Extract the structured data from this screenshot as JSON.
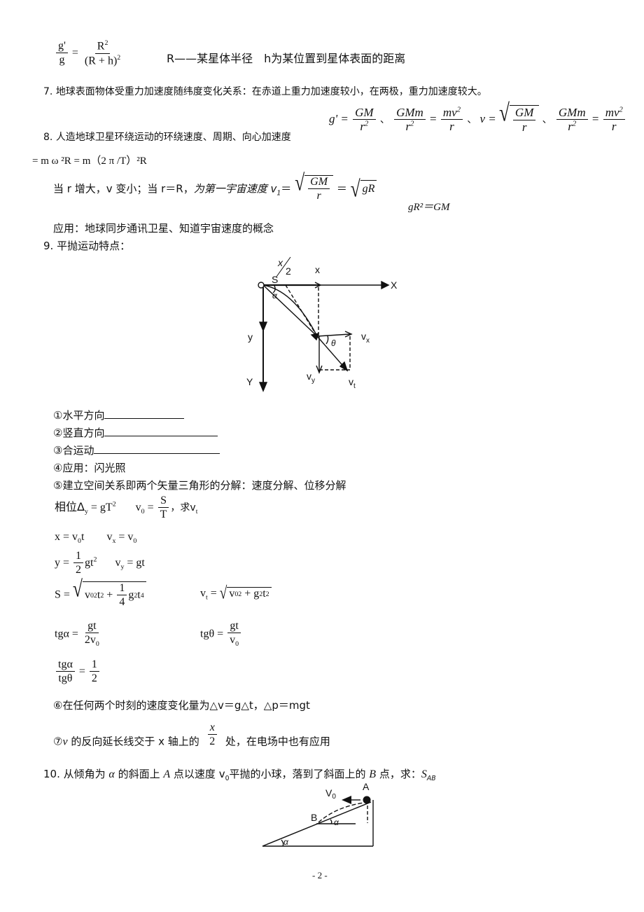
{
  "page_number": "- 2 -",
  "s6": {
    "lhs_num": "g'",
    "lhs_den": "g",
    "rhs_num": "R",
    "rhs_num_exp": "2",
    "rhs_den": "(R + h)",
    "rhs_den_exp": "2",
    "note": "R——某星体半径　h为某位置到星体表面的距离"
  },
  "s7": {
    "number": "7.",
    "text": "地球表面物体受重力加速度随纬度变化关系：在赤道上重力加速度较小，在两极，重力加速度较大。"
  },
  "s8": {
    "number": "8.",
    "text": "人造地球卫星环绕运动的环绕速度、周期、向心加速度",
    "g_prime": "g' =",
    "f1_num": "GM",
    "f1_den": "r",
    "f1_den_exp": "2",
    "sep1": "、",
    "f2_num": "GMm",
    "f2_den": "r",
    "f2_den_exp": "2",
    "eq": "=",
    "f3_num": "mv",
    "f3_num_exp": "2",
    "f3_den": "r",
    "sep2": "、",
    "v_eq": "v =",
    "f4_num": "GM",
    "f4_den": "r",
    "sep3": "、",
    "f5_num": "GMm",
    "f5_den": "r",
    "f5_den_exp": "2",
    "f6_num": "mv",
    "f6_num_exp": "2",
    "f6_den": "r",
    "cont_line": "= m ω ²R = m（2 π /T）²R",
    "line2_a": "当 r 增大，v 变小；当 r＝R，",
    "line2_b": "为第一宇宙速度 v",
    "line2_sub": "1",
    "line2_eq": "＝",
    "line2_sqrt_num": "GM",
    "line2_sqrt_den": "r",
    "line2_eq2": "＝",
    "line2_sqrt2": "gR",
    "line2_c": "gR²＝GM",
    "application": "应用：地球同步通讯卫星、知道宇宙速度的概念"
  },
  "s9": {
    "number": "9.",
    "title": "平抛运动特点：",
    "diagram_labels": {
      "half_x_num": "x",
      "half_x_den": "2",
      "x_small": "x",
      "X_axis": "X",
      "origin": "O",
      "S": "S",
      "alpha": "α",
      "y_small": "y",
      "Y_axis": "Y",
      "theta": "θ",
      "vx": "v",
      "vx_sub": "x",
      "vy": "v",
      "vy_sub": "y",
      "vt": "v",
      "vt_sub": "t"
    },
    "items": [
      {
        "label": "①水平方向",
        "blank": true
      },
      {
        "label": "②竖直方向",
        "blank": true
      },
      {
        "label": "③合运动",
        "blank": true
      },
      {
        "label": "④应用：闪光照",
        "blank": false
      },
      {
        "label": "⑤建立空间关系即两个矢量三角形的分解：速度分解、位移分解",
        "blank": false
      }
    ],
    "eq1_a": "相位Δ",
    "eq1_a_sub": "y",
    "eq1_b": " = gT",
    "eq1_b_exp": "2",
    "eq1_c": "v",
    "eq1_c_sub": "0",
    "eq1_frac_num": "S",
    "eq1_frac_den": "T",
    "eq1_d": "，求v",
    "eq1_d_sub": "t",
    "eq2_a": "x = v",
    "eq2_a_sub": "0",
    "eq2_a_tail": "t",
    "eq2_b": "v",
    "eq2_b_sub": "x",
    "eq2_b_tail": " = v",
    "eq2_b_sub2": "0",
    "eq3_a": "y =",
    "eq3_frac_num": "1",
    "eq3_frac_den": "2",
    "eq3_tail": "gt",
    "eq3_exp": "2",
    "eq3_b": "v",
    "eq3_b_sub": "y",
    "eq3_b_tail": " = gt",
    "eq4_a": "S =",
    "eq4_inner_a": "v",
    "eq4_inner_sub": "0",
    "eq4_inner_exp": "2",
    "eq4_inner_b": "t",
    "eq4_inner_b_exp": "2",
    "eq4_plus": " + ",
    "eq4_frac_num": "1",
    "eq4_frac_den": "4",
    "eq4_inner_c": "g",
    "eq4_inner_c_exp": "2",
    "eq4_inner_d": "t",
    "eq4_inner_d_exp": "4",
    "eq4_b": "v",
    "eq4_b_sub": "t",
    "eq4_b_eq": " =",
    "eq4_b_inner": "v",
    "eq4_b_inner_sub": "0",
    "eq4_b_inner_exp": "2",
    "eq4_b_inner_plus": " + g",
    "eq4_b_inner_exp2": "2",
    "eq4_b_inner_t": "t",
    "eq4_b_inner_exp3": "2",
    "eq5_a": "tgα =",
    "eq5_a_num": "gt",
    "eq5_a_den": "2v",
    "eq5_a_den_sub": "0",
    "eq5_b": "tgθ =",
    "eq5_b_num": "gt",
    "eq5_b_den": "v",
    "eq5_b_den_sub": "0",
    "eq6_num": "tgα",
    "eq6_den": "tgθ",
    "eq6_eq": "=",
    "eq6_rnum": "1",
    "eq6_rden": "2",
    "item6": "⑥在任何两个时刻的速度变化量为△v＝g△t，△p＝mgt",
    "item7_a": "⑦",
    "item7_v": "v",
    "item7_b": " 的反向延长线交于 x 轴上的 ",
    "item7_frac_num": "x",
    "item7_frac_den": "2",
    "item7_c": " 处，在电场中也有应用"
  },
  "s10": {
    "number": "10.",
    "text_a": "从倾角为 ",
    "alpha": "α",
    "text_b": " 的斜面上 ",
    "A": "A",
    "text_c": " 点以速度 v",
    "v_sub": "0",
    "text_d": "平抛的小球，落到了斜面上的 ",
    "B": "B",
    "text_e": " 点，求：",
    "S": "S",
    "S_sub": "AB",
    "diagram_labels": {
      "V0": "V",
      "V0_sub": "0",
      "A": "A",
      "B": "B",
      "alpha1": "α",
      "alpha2": "α"
    }
  }
}
